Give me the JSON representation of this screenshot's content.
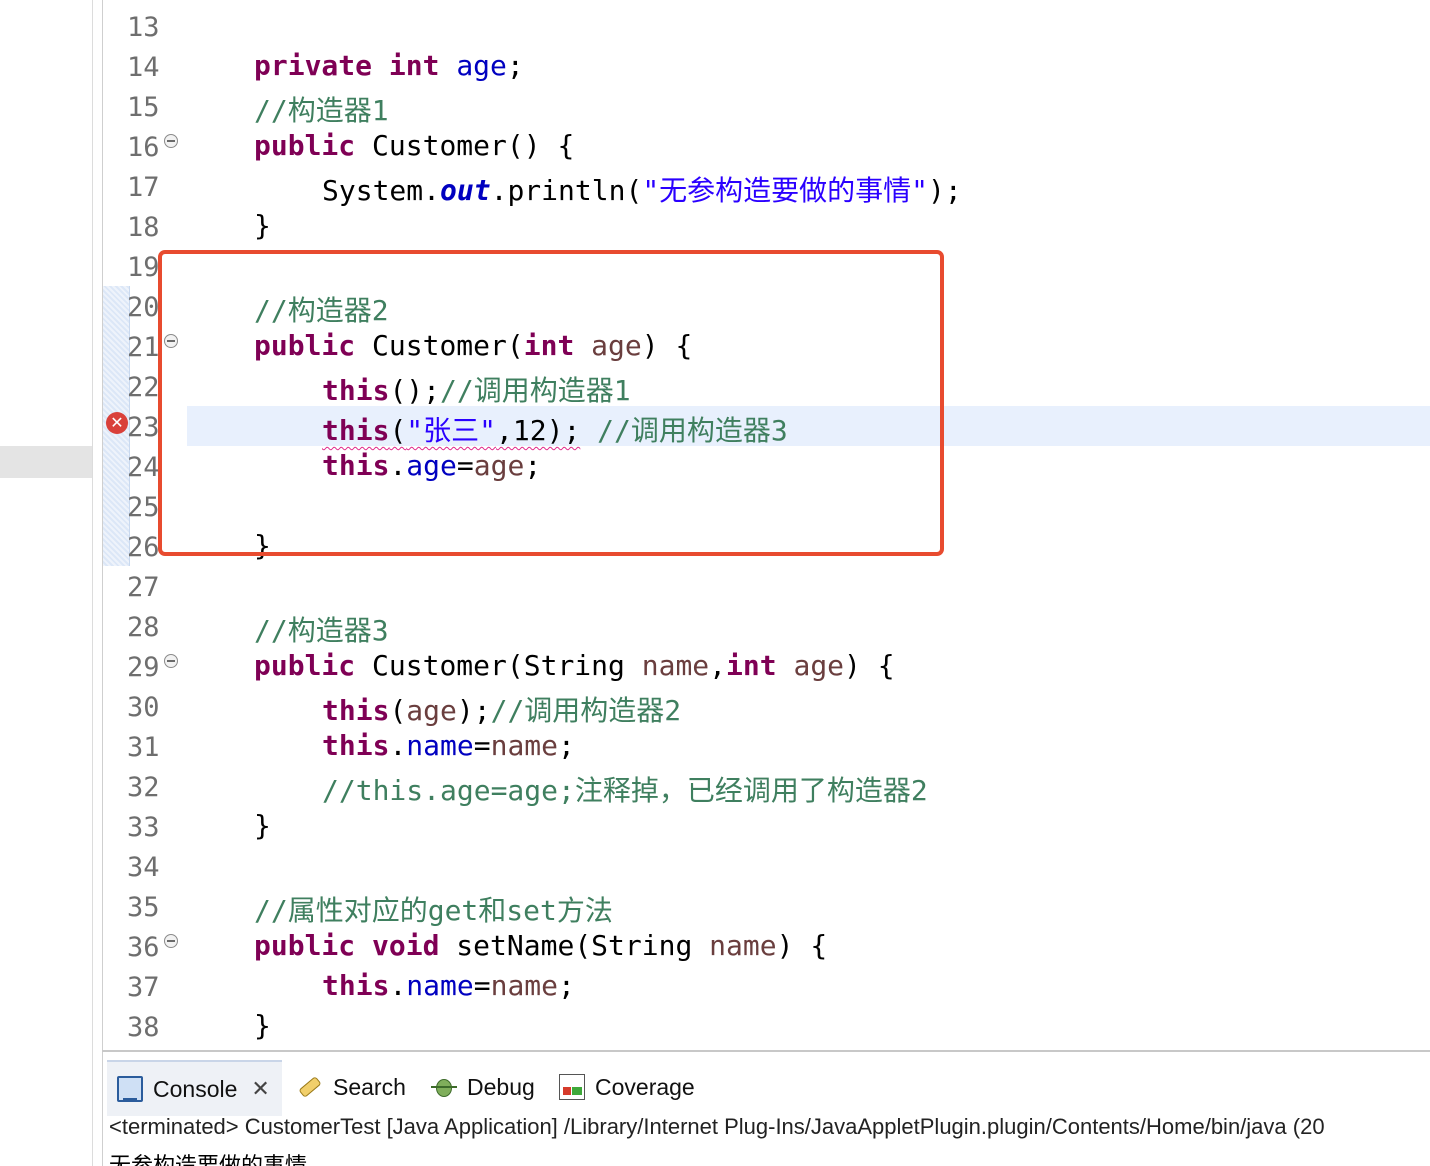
{
  "editor": {
    "lines": [
      {
        "n": "13"
      },
      {
        "n": "14"
      },
      {
        "n": "15"
      },
      {
        "n": "16"
      },
      {
        "n": "17"
      },
      {
        "n": "18"
      },
      {
        "n": "19"
      },
      {
        "n": "20"
      },
      {
        "n": "21"
      },
      {
        "n": "22"
      },
      {
        "n": "23"
      },
      {
        "n": "24"
      },
      {
        "n": "25"
      },
      {
        "n": "26"
      },
      {
        "n": "27"
      },
      {
        "n": "28"
      },
      {
        "n": "29"
      },
      {
        "n": "30"
      },
      {
        "n": "31"
      },
      {
        "n": "32"
      },
      {
        "n": "33"
      },
      {
        "n": "34"
      },
      {
        "n": "35"
      },
      {
        "n": "36"
      },
      {
        "n": "37"
      },
      {
        "n": "38"
      }
    ],
    "tokens": {
      "l14": {
        "kw1": "private",
        "kw2": "int",
        "f": "age",
        "p": ";"
      },
      "l15": {
        "c": "//构造器1"
      },
      "l16": {
        "kw": "public",
        "t": " Customer() {"
      },
      "l17": {
        "a": "System.",
        "f": "out",
        "b": ".println(",
        "s": "\"无参构造要做的事情\"",
        "e": ");"
      },
      "l18": {
        "t": "}"
      },
      "l20": {
        "c": "//构造器2"
      },
      "l21": {
        "kw": "public",
        "t1": " Customer(",
        "kw2": "int",
        "p": " age",
        "t2": ") {"
      },
      "l22": {
        "kw": "this",
        "t": "();",
        "c": "//调用构造器1"
      },
      "l23": {
        "kw": "this",
        "t1": "(",
        "s": "\"张三\"",
        "t2": ",12);",
        "c": " //调用构造器3"
      },
      "l24": {
        "kw": "this",
        "t": ".",
        "f": "age",
        "e": "=",
        "p": "age",
        "z": ";"
      },
      "l26": {
        "t": "}"
      },
      "l28": {
        "c": "//构造器3"
      },
      "l29": {
        "kw": "public",
        "t1": " Customer(String ",
        "p1": "name",
        "t2": ",",
        "kw2": "int",
        "p2": " age",
        "t3": ") {"
      },
      "l30": {
        "kw": "this",
        "t1": "(",
        "p": "age",
        "t2": ");",
        "c": "//调用构造器2"
      },
      "l31": {
        "kw": "this",
        "t": ".",
        "f": "name",
        "e": "=",
        "p": "name",
        "z": ";"
      },
      "l32": {
        "c": "//this.age=age;注释掉，已经调用了构造器2"
      },
      "l33": {
        "t": "}"
      },
      "l35": {
        "c": "//属性对应的get和set方法"
      },
      "l36": {
        "kw1": "public",
        "kw2": "void",
        "t1": " setName(String ",
        "p": "name",
        "t2": ") {"
      },
      "l37": {
        "kw": "this",
        "t": ".",
        "f": "name",
        "e": "=",
        "p": "name",
        "z": ";"
      },
      "l38": {
        "t": "}"
      }
    }
  },
  "console_panel": {
    "tabs": {
      "console": "Console",
      "search": "Search",
      "debug": "Debug",
      "coverage": "Coverage"
    },
    "status": "<terminated> CustomerTest [Java Application] /Library/Internet Plug-Ins/JavaAppletPlugin.plugin/Contents/Home/bin/java  (20",
    "output": "无参构造要做的事情"
  },
  "colors": {
    "keyword": "#7f0055",
    "comment": "#3f7f5f",
    "string": "#2a00ff",
    "field": "#0000c0",
    "highlight_box": "#e84b2f"
  }
}
